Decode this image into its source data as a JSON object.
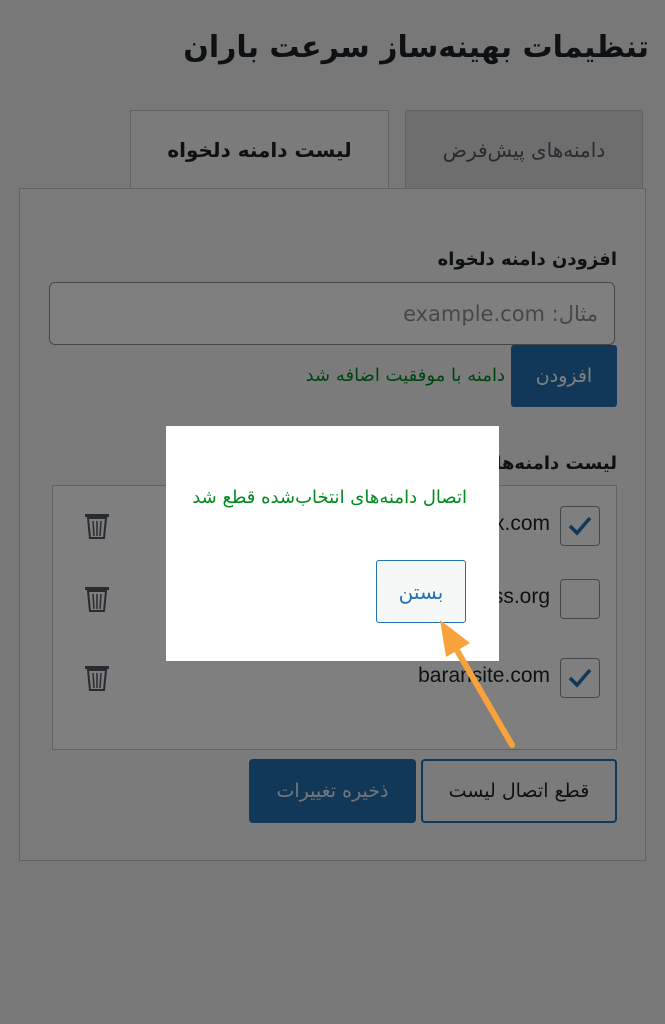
{
  "page": {
    "title": "تنظیمات بهینه‌ساز سرعت باران"
  },
  "tabs": [
    {
      "label": "دامنه‌های پیش‌فرض",
      "active": false
    },
    {
      "label": "لیست دامنه دلخواه",
      "active": true
    }
  ],
  "add_domain": {
    "label": "افزودن دامنه دلخواه",
    "placeholder": "مثال: example.com",
    "button_label": "افزودن",
    "success_message": "دامنه با موفقیت اضافه شد"
  },
  "list": {
    "label": "لیست دامنه‌ها",
    "items": [
      {
        "domain": "x.com",
        "checked": true
      },
      {
        "domain": "ss.org",
        "checked": false
      },
      {
        "domain": "baransite.com",
        "checked": true
      }
    ]
  },
  "actions": {
    "disconnect_label": "قطع اتصال لیست",
    "save_label": "ذخیره تغییرات"
  },
  "modal": {
    "message": "اتصال دامنه‌های انتخاب‌شده قطع شد",
    "close_label": "بستن"
  },
  "colors": {
    "accent": "#2271b1",
    "success": "#008a20",
    "annotation_arrow": "#f7a23b"
  },
  "icons": {
    "trash": "trash-icon",
    "check": "checkmark-icon",
    "arrow": "arrow-icon"
  }
}
